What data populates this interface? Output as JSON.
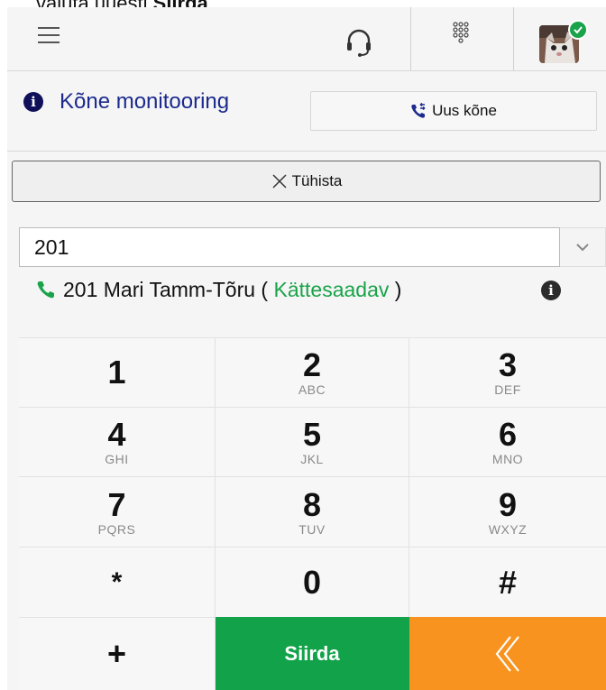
{
  "caption": {
    "prefix": "vajuta uuesti ",
    "bold": "Siirda",
    "suffix": "."
  },
  "topbar": {
    "menu_icon": "hamburger-icon",
    "headset_icon": "headset-icon",
    "dialpad_icon": "dialpad-icon",
    "avatar_status": "online"
  },
  "monitor": {
    "label": "Kõne monitooring",
    "icon": "info-icon"
  },
  "new_call": {
    "label": "Uus kõne",
    "icon": "phone-transfer-icon"
  },
  "cancel": {
    "label": "Tühista",
    "icon": "close-icon"
  },
  "search": {
    "value": "201"
  },
  "suggestion": {
    "number_name": "201 Mari Tamm-Tõru",
    "open_paren": " ( ",
    "status": "Kättesaadav",
    "close_paren": " )"
  },
  "keys": [
    {
      "digit": "1",
      "letters": ""
    },
    {
      "digit": "2",
      "letters": "ABC"
    },
    {
      "digit": "3",
      "letters": "DEF"
    },
    {
      "digit": "4",
      "letters": "GHI"
    },
    {
      "digit": "5",
      "letters": "JKL"
    },
    {
      "digit": "6",
      "letters": "MNO"
    },
    {
      "digit": "7",
      "letters": "PQRS"
    },
    {
      "digit": "8",
      "letters": "TUV"
    },
    {
      "digit": "9",
      "letters": "WXYZ"
    },
    {
      "digit": "*",
      "letters": ""
    },
    {
      "digit": "0",
      "letters": ""
    },
    {
      "digit": "#",
      "letters": ""
    }
  ],
  "actions": {
    "plus": "+",
    "transfer": "Siirda",
    "back_icon": "double-chevron-left-icon"
  },
  "colors": {
    "accent": "#1b2a8c",
    "transfer": "#12a34a",
    "back": "#f7931e",
    "available": "#1aa34a"
  }
}
